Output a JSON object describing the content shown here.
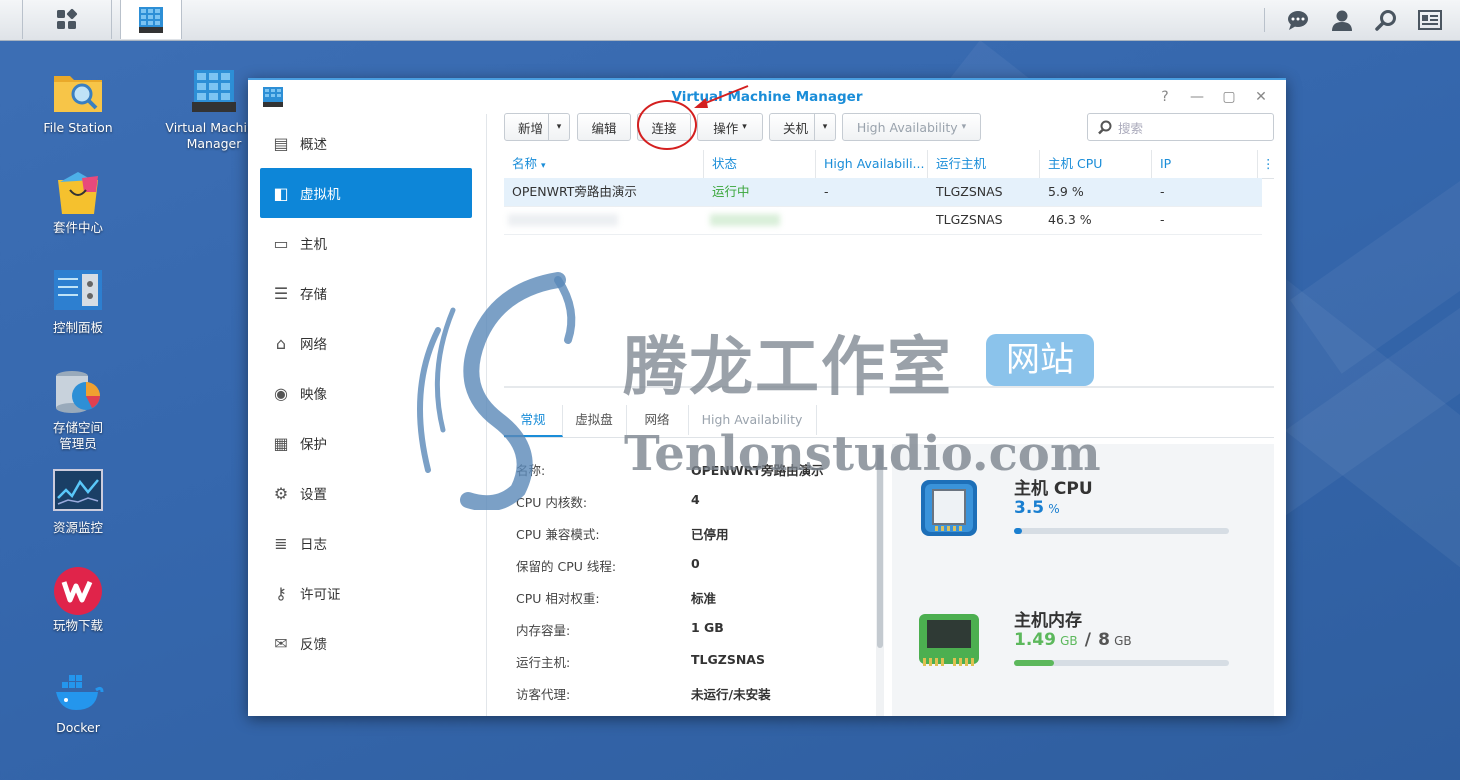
{
  "desktop": {
    "icons": [
      {
        "label": "File Station"
      },
      {
        "label": "Virtual Machine Manager"
      },
      {
        "label": "套件中心"
      },
      {
        "label": "控制面板"
      },
      {
        "label": "存储空间管理员"
      },
      {
        "label": "资源监控"
      },
      {
        "label": "玩物下载"
      },
      {
        "label": "Docker"
      }
    ]
  },
  "window": {
    "title": "Virtual Machine Manager",
    "controls": [
      "?",
      "—",
      "▢",
      "✕"
    ]
  },
  "sidebar": {
    "items": [
      {
        "label": "概述",
        "icon": "overview-icon"
      },
      {
        "label": "虚拟机",
        "icon": "virtual-machine-icon",
        "active": true
      },
      {
        "label": "主机",
        "icon": "host-icon"
      },
      {
        "label": "存储",
        "icon": "storage-icon"
      },
      {
        "label": "网络",
        "icon": "network-icon"
      },
      {
        "label": "映像",
        "icon": "image-icon"
      },
      {
        "label": "保护",
        "icon": "protection-icon"
      },
      {
        "label": "设置",
        "icon": "settings-icon"
      },
      {
        "label": "日志",
        "icon": "log-icon"
      },
      {
        "label": "许可证",
        "icon": "license-icon"
      },
      {
        "label": "反馈",
        "icon": "feedback-icon"
      }
    ]
  },
  "toolbar": {
    "new_label": "新增",
    "edit_label": "编辑",
    "connect_label": "连接",
    "action_label": "操作",
    "shutdown_label": "关机",
    "ha_label": "High Availability",
    "search_placeholder": "搜索"
  },
  "table": {
    "columns": [
      "名称",
      "状态",
      "High Availabili...",
      "运行主机",
      "主机 CPU",
      "IP"
    ],
    "rows": [
      {
        "name": "OPENWRT旁路由演示",
        "status": "运行中",
        "ha": "-",
        "host": "TLGZSNAS",
        "cpu": "5.9 %",
        "ip": "-"
      },
      {
        "name": "",
        "status": "",
        "ha": "",
        "host": "TLGZSNAS",
        "cpu": "46.3 %",
        "ip": "-"
      }
    ]
  },
  "detail": {
    "tabs": [
      "常规",
      "虚拟盘",
      "网络",
      "High Availability"
    ],
    "props": [
      {
        "label": "名称:",
        "value": "OPENWRT旁路由演示"
      },
      {
        "label": "CPU 内核数:",
        "value": "4"
      },
      {
        "label": "CPU 兼容模式:",
        "value": "已停用"
      },
      {
        "label": "保留的 CPU 线程:",
        "value": "0"
      },
      {
        "label": "CPU 相对权重:",
        "value": "标准"
      },
      {
        "label": "内存容量:",
        "value": "1 GB"
      },
      {
        "label": "运行主机:",
        "value": "TLGZSNAS"
      },
      {
        "label": "访客代理:",
        "value": "未运行/未安装"
      }
    ],
    "cpu": {
      "title": "主机 CPU",
      "value": "3.5",
      "unit": "%",
      "fraction": 0.035
    },
    "memory": {
      "title": "主机内存",
      "used": "1.49",
      "used_unit": "GB",
      "sep": "/",
      "total": "8",
      "total_unit": "GB",
      "fraction": 0.186
    }
  },
  "watermark": {
    "text_cn": "腾龙工作室",
    "badge": "网站",
    "domain": "Tenlonstudio.com"
  },
  "colors": {
    "accent": "#0d86d8",
    "running": "#3aa63a",
    "memory_bar": "#5cb85c",
    "cpu_bar": "#1a7fd0"
  }
}
